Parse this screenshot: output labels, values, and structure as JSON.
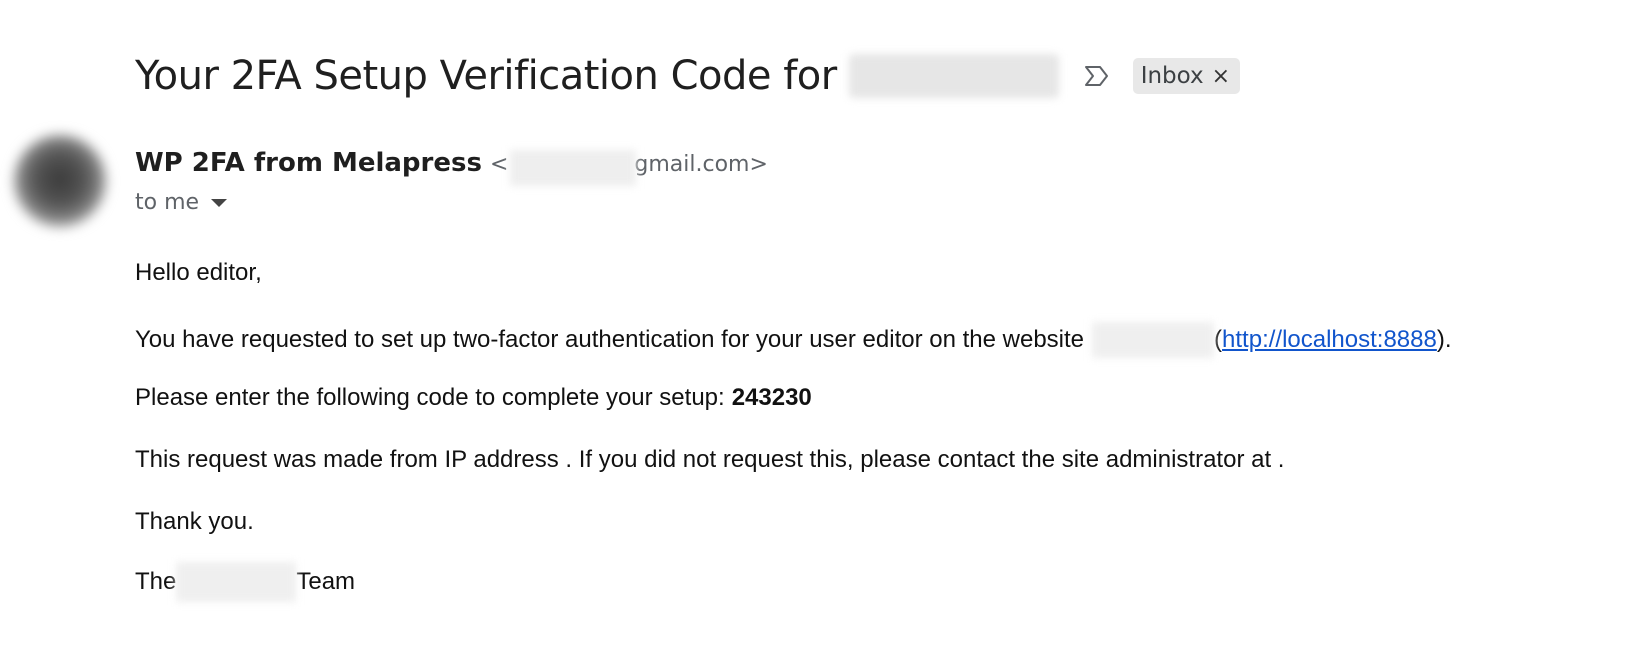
{
  "email": {
    "subject": "Your 2FA Setup Verification Code for",
    "label": "Inbox",
    "label_close": "×",
    "sender_name": "WP 2FA from Melapress",
    "sender_email_prefix": "<",
    "sender_email_suffix": "gmail.com>",
    "recipient": "to me"
  },
  "body": {
    "greeting": "Hello editor,",
    "line1_text": "You have requested to set up two-factor authentication for your user editor on the website",
    "line1_paren_open": "(",
    "line1_link": "http://localhost:8888",
    "line1_paren_close": ").",
    "line2_text": "Please enter the following code to complete your setup:",
    "code": "243230",
    "line3_text": "This request was made from IP address . If you did not request this, please contact the site administrator at .",
    "thanks": "Thank you.",
    "signoff_prefix": "The",
    "signoff_suffix": "Team"
  },
  "icons": {
    "important": "important-marker-icon",
    "label_remove": "close-icon",
    "details": "caret-down-icon"
  },
  "colors": {
    "link": "#1155cc",
    "chip_bg": "#e8e8e8",
    "secondary_text": "#5f6368"
  }
}
